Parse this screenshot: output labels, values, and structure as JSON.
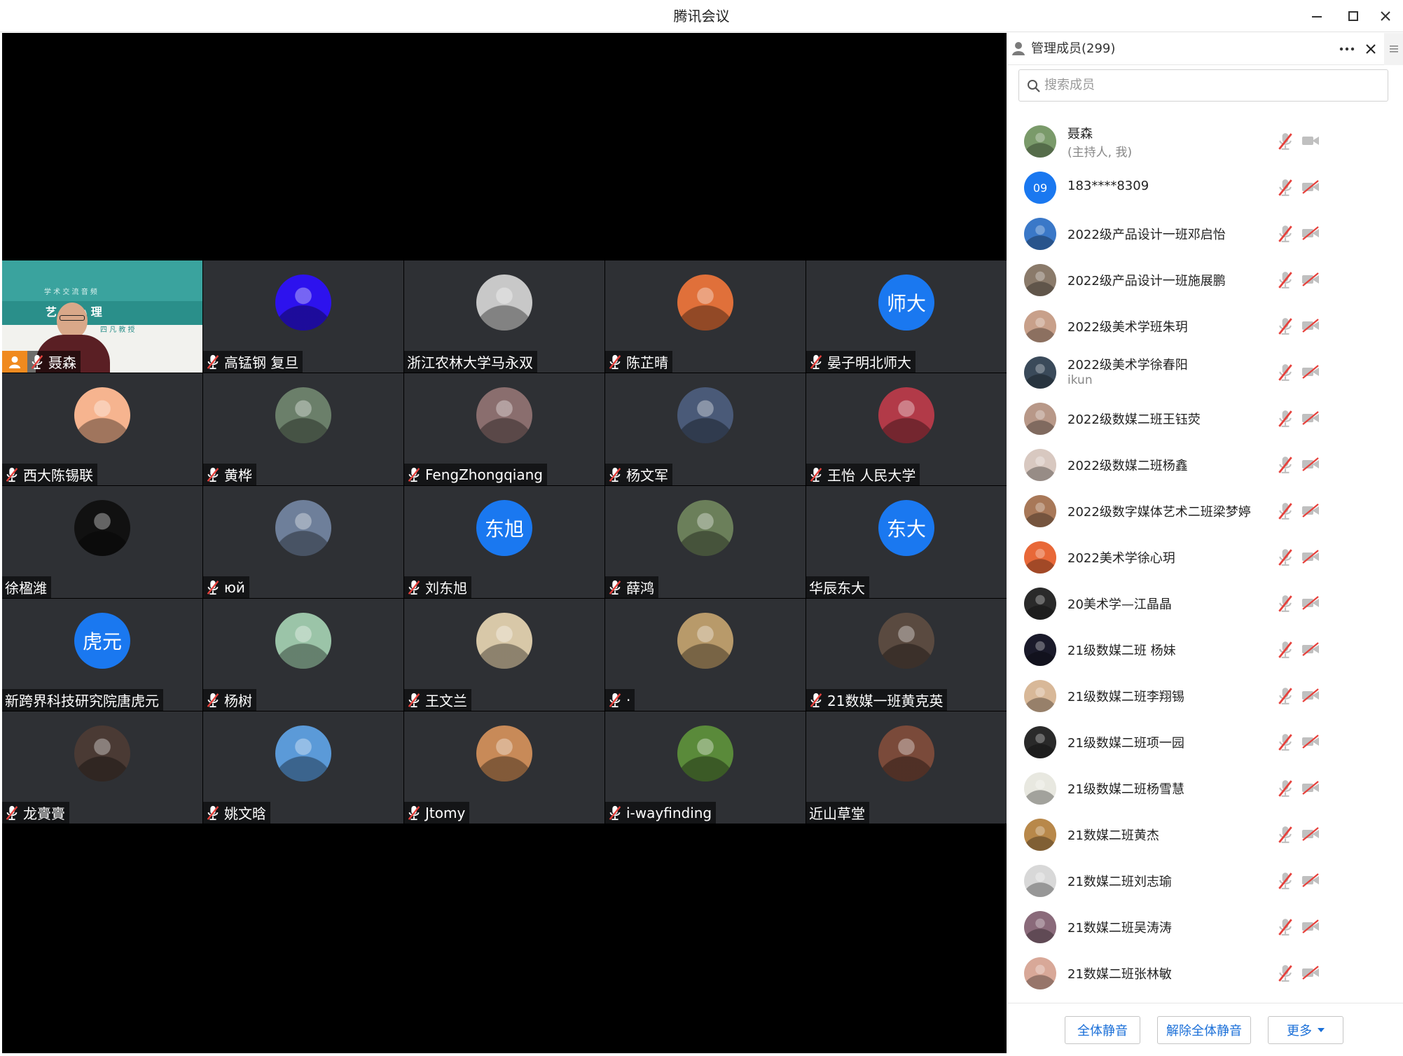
{
  "window": {
    "title": "腾讯会议"
  },
  "tiles": [
    {
      "name": "聂森",
      "avatar": "slide",
      "color": "#2a8f8a",
      "muted": true
    },
    {
      "name": "高锰钢 复旦",
      "avatar": "image",
      "color": "#2d12ee",
      "muted": true
    },
    {
      "name": "浙江农林大学马永双",
      "avatar": "image",
      "color": "#c8c8c8",
      "muted": false
    },
    {
      "name": "陈芷晴",
      "avatar": "image",
      "color": "#e0703a",
      "muted": true
    },
    {
      "name": "晏子明北师大",
      "avatar": "text",
      "avatar_text": "师大",
      "color": "#1a78f0",
      "muted": true
    },
    {
      "name": "西大陈锡联",
      "avatar": "image",
      "color": "#f6b48f",
      "muted": true
    },
    {
      "name": "黄桦",
      "avatar": "image",
      "color": "#6b7f6a",
      "muted": true
    },
    {
      "name": "FengZhongqiang",
      "avatar": "image",
      "color": "#8a6e6e",
      "muted": true
    },
    {
      "name": "杨文军",
      "avatar": "image",
      "color": "#4a5a78",
      "muted": true
    },
    {
      "name": "王怡  人民大学",
      "avatar": "image",
      "color": "#b23a48",
      "muted": true
    },
    {
      "name": "徐楹潍",
      "avatar": "image",
      "color": "#111111",
      "muted": false
    },
    {
      "name": "юй",
      "avatar": "image",
      "color": "#6e7f9a",
      "muted": true
    },
    {
      "name": "刘东旭",
      "avatar": "text",
      "avatar_text": "东旭",
      "color": "#1a78f0",
      "muted": true
    },
    {
      "name": "薛鸿",
      "avatar": "image",
      "color": "#6b7f5a",
      "muted": true
    },
    {
      "name": "华辰东大",
      "avatar": "text",
      "avatar_text": "东大",
      "color": "#1a78f0",
      "muted": false
    },
    {
      "name": "新跨界科技研究院唐虎元",
      "avatar": "text",
      "avatar_text": "虎元",
      "color": "#1a78f0",
      "muted": false
    },
    {
      "name": "杨树",
      "avatar": "image",
      "color": "#9bc4a8",
      "muted": true
    },
    {
      "name": "王文兰",
      "avatar": "image",
      "color": "#d8c8a8",
      "muted": true
    },
    {
      "name": "·",
      "avatar": "image",
      "color": "#b89a6a",
      "muted": true
    },
    {
      "name": "21数媒一班黄克英",
      "avatar": "image",
      "color": "#5a4a40",
      "muted": true
    },
    {
      "name": "龙賷賷",
      "avatar": "image",
      "color": "#4a3a34",
      "muted": true
    },
    {
      "name": "姚文晗",
      "avatar": "image",
      "color": "#5b9ad8",
      "muted": true
    },
    {
      "name": "Jtomy",
      "avatar": "image",
      "color": "#c88a58",
      "muted": true
    },
    {
      "name": "i-wayfinding",
      "avatar": "image",
      "color": "#5a8a3a",
      "muted": true
    },
    {
      "name": "近山草堂",
      "avatar": "image",
      "color": "#7a4a3a",
      "muted": false
    }
  ],
  "panel": {
    "title": "管理成员(299)",
    "search_placeholder": "搜索成员",
    "members": [
      {
        "name": "聂森",
        "sub": "(主持人, 我)",
        "avatar": "image",
        "color": "#7a9a6a",
        "cam_on": true
      },
      {
        "name": "183****8309",
        "avatar": "text",
        "avatar_text": "09",
        "color": "#1a78f0",
        "cam_on": false
      },
      {
        "name": "2022级产品设计一班邓启怡",
        "avatar": "image",
        "color": "#3a78c8",
        "cam_on": false
      },
      {
        "name": "2022级产品设计一班施展鹏",
        "avatar": "image",
        "color": "#8a7a6a",
        "cam_on": false
      },
      {
        "name": "2022级美术学班朱玥",
        "avatar": "image",
        "color": "#c8a08a",
        "cam_on": false
      },
      {
        "name": "2022级美术学徐春阳",
        "sub": "ikun",
        "avatar": "image",
        "color": "#3a4a5a",
        "cam_on": false
      },
      {
        "name": "2022级数媒二班王钰荧",
        "avatar": "image",
        "color": "#b89888",
        "cam_on": false
      },
      {
        "name": "2022级数媒二班杨鑫",
        "avatar": "image",
        "color": "#d8c8c0",
        "cam_on": false
      },
      {
        "name": "2022级数字媒体艺术二班梁梦婷",
        "avatar": "image",
        "color": "#a87858",
        "cam_on": false
      },
      {
        "name": "2022美术学徐心玥",
        "avatar": "image",
        "color": "#e86838",
        "cam_on": false
      },
      {
        "name": "20美术学—江晶晶",
        "avatar": "image",
        "color": "#2a2a2a",
        "cam_on": false
      },
      {
        "name": "21级数媒二班 杨妹",
        "avatar": "image",
        "color": "#1a1a2a",
        "cam_on": false
      },
      {
        "name": "21级数媒二班李翔锡",
        "avatar": "image",
        "color": "#d8b898",
        "cam_on": false
      },
      {
        "name": "21级数媒二班项一园",
        "avatar": "image",
        "color": "#2a2a2a",
        "cam_on": false
      },
      {
        "name": "21级数媒二班杨雪慧",
        "avatar": "image",
        "color": "#e8e8e0",
        "cam_on": false
      },
      {
        "name": "21数媒二班黄杰",
        "avatar": "image",
        "color": "#b8884a",
        "cam_on": false
      },
      {
        "name": "21数媒二班刘志瑜",
        "avatar": "image",
        "color": "#d8d8d8",
        "cam_on": false
      },
      {
        "name": "21数媒二班吴涛涛",
        "avatar": "image",
        "color": "#8a6a7a",
        "cam_on": false
      },
      {
        "name": "21数媒二班张林敏",
        "avatar": "image",
        "color": "#d8a898",
        "cam_on": false
      }
    ],
    "footer": {
      "mute_all": "全体静音",
      "unmute_all": "解除全体静音",
      "more": "更多"
    }
  },
  "slide": {
    "line1": "学 术 交 流 音 频",
    "line2": "艺 与 心 理",
    "line3": "四 凡 教 授"
  }
}
